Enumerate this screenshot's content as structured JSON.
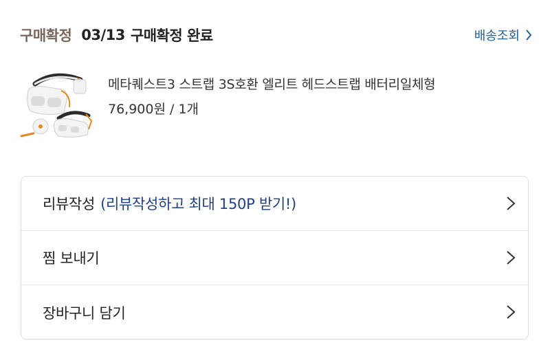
{
  "order": {
    "status_label": "구매확정",
    "date": "03/13",
    "status_text": "구매확정 완료",
    "track_label": "배송조회"
  },
  "product": {
    "name": "메타퀘스트3 스트랩 3S호환 엘리트 헤드스트랩 배터리일체형",
    "price_qty": "76,900원 / 1개"
  },
  "menu": [
    {
      "label": "리뷰작성",
      "note": "(리뷰작성하고 최대 150P 받기!)"
    },
    {
      "label": "찜 보내기",
      "note": ""
    },
    {
      "label": "장바구니 담기",
      "note": ""
    }
  ],
  "colors": {
    "status_label": "#7a665a",
    "link": "#1f5f9a",
    "review_note": "#1f3f8a",
    "border": "#dedede"
  },
  "icons": [
    "chevron-right-icon"
  ]
}
